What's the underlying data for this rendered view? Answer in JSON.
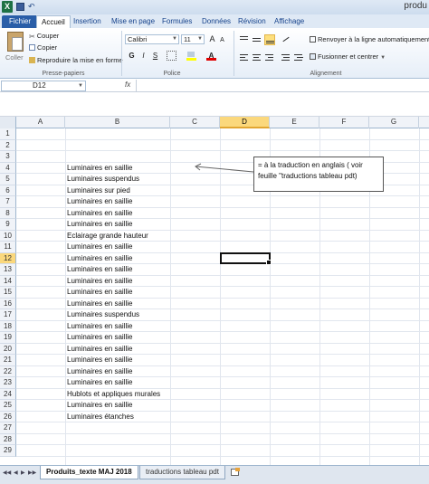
{
  "titlebar": {
    "title_fragment": "produ"
  },
  "ribbon_tabs": [
    "Fichier",
    "Accueil",
    "Insertion",
    "Mise en page",
    "Formules",
    "Données",
    "Révision",
    "Affichage"
  ],
  "clipboard": {
    "paste_label": "Coller",
    "cut_label": "Couper",
    "copy_label": "Copier",
    "format_painter_label": "Reproduire la mise en forme",
    "group_label": "Presse-papiers"
  },
  "font": {
    "name": "Calibri",
    "size": "11",
    "group_label": "Police",
    "bold": "G",
    "italic": "I",
    "underline": "S"
  },
  "alignment": {
    "wrap_text_label": "Renvoyer à la ligne automatiquement",
    "merge_label": "Fusionner et centrer",
    "group_label": "Alignement"
  },
  "formula_bar": {
    "name_box": "D12",
    "fx": "fx",
    "value": ""
  },
  "columns": [
    {
      "letter": "A",
      "selected": false
    },
    {
      "letter": "B",
      "selected": false
    },
    {
      "letter": "C",
      "selected": false
    },
    {
      "letter": "D",
      "selected": true
    },
    {
      "letter": "E",
      "selected": false
    },
    {
      "letter": "F",
      "selected": false
    },
    {
      "letter": "G",
      "selected": false
    }
  ],
  "rows": [
    {
      "n": "1",
      "b": ""
    },
    {
      "n": "2",
      "b": ""
    },
    {
      "n": "3",
      "b": ""
    },
    {
      "n": "4",
      "b": "Luminaires en saillie"
    },
    {
      "n": "5",
      "b": "Luminaires suspendus"
    },
    {
      "n": "6",
      "b": "Luminaires sur pied"
    },
    {
      "n": "7",
      "b": "Luminaires en saillie"
    },
    {
      "n": "8",
      "b": "Luminaires en saillie"
    },
    {
      "n": "9",
      "b": "Luminaires en saillie"
    },
    {
      "n": "10",
      "b": "Eclairage grande hauteur"
    },
    {
      "n": "11",
      "b": "Luminaires en saillie"
    },
    {
      "n": "12",
      "b": "Luminaires en saillie"
    },
    {
      "n": "13",
      "b": "Luminaires en saillie"
    },
    {
      "n": "14",
      "b": "Luminaires en saillie"
    },
    {
      "n": "15",
      "b": "Luminaires en saillie"
    },
    {
      "n": "16",
      "b": "Luminaires en saillie"
    },
    {
      "n": "17",
      "b": "Luminaires suspendus"
    },
    {
      "n": "18",
      "b": "Luminaires en saillie"
    },
    {
      "n": "19",
      "b": "Luminaires en saillie"
    },
    {
      "n": "20",
      "b": "Luminaires en saillie"
    },
    {
      "n": "21",
      "b": "Luminaires en saillie"
    },
    {
      "n": "22",
      "b": "Luminaires en saillie"
    },
    {
      "n": "23",
      "b": "Luminaires en saillie"
    },
    {
      "n": "24",
      "b": "Hublots et appliques murales"
    },
    {
      "n": "25",
      "b": "Luminaires en saillie"
    },
    {
      "n": "26",
      "b": "Luminaires étanches"
    },
    {
      "n": "27",
      "b": ""
    },
    {
      "n": "28",
      "b": ""
    },
    {
      "n": "29",
      "b": ""
    }
  ],
  "selected_row": "12",
  "note": {
    "line1": "= à la traduction en anglais ( voir",
    "line2": "feuille \"traductions tableau pdt)"
  },
  "sheets": [
    {
      "name": "Produits_texte MAJ 2018",
      "active": true
    },
    {
      "name": "traductions tableau pdt",
      "active": false
    }
  ],
  "colors": {
    "accent": "#2a5ea8",
    "selection": "#fbd87c",
    "excel_green": "#1e7145"
  }
}
